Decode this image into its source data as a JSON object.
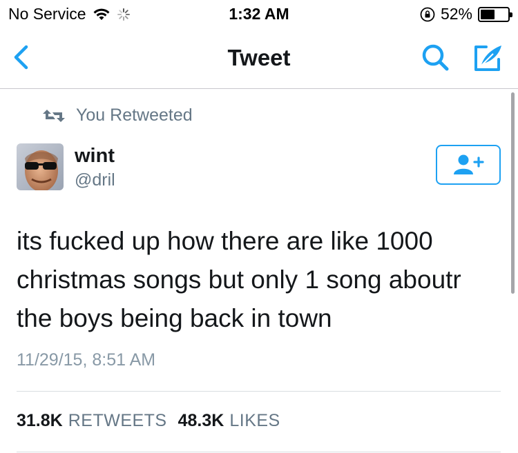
{
  "status_bar": {
    "carrier": "No Service",
    "time": "1:32 AM",
    "battery_percent": "52%",
    "battery_level": 0.52
  },
  "nav": {
    "title": "Tweet",
    "accent_color": "#1da1f2"
  },
  "tweet": {
    "retweet_context": "You Retweeted",
    "display_name": "wint",
    "handle": "@dril",
    "text": "its fucked up how there are like 1000 christmas songs but only 1 song aboutr the boys being back in town",
    "timestamp": "11/29/15, 8:51 AM",
    "stats": {
      "retweets_count": "31.8K",
      "retweets_label": "RETWEETS",
      "likes_count": "48.3K",
      "likes_label": "LIKES"
    }
  },
  "icons": {
    "back": "chevron-left-icon",
    "search": "search-icon",
    "compose": "compose-icon",
    "follow": "add-user-icon",
    "retweet": "retweet-icon",
    "wifi": "wifi-icon",
    "activity": "spinner-icon",
    "lock": "rotation-lock-icon",
    "battery": "battery-icon"
  }
}
